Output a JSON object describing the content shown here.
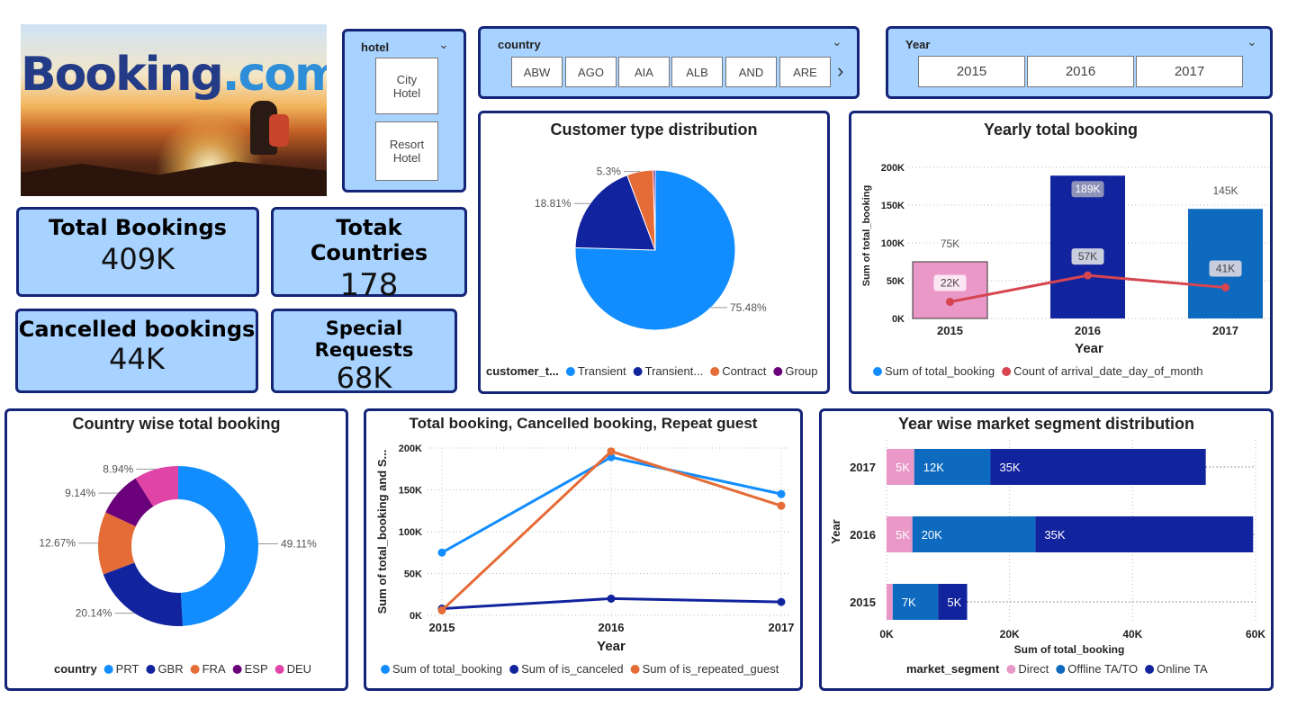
{
  "logo": {
    "text_main": "Booking",
    "text_dot": ".com"
  },
  "hotel_slicer": {
    "title": "hotel",
    "items": [
      "City Hotel",
      "Resort Hotel"
    ]
  },
  "country_slicer": {
    "title": "country",
    "items": [
      "ABW",
      "AGO",
      "AIA",
      "ALB",
      "AND",
      "ARE"
    ]
  },
  "year_slicer": {
    "title": "Year",
    "items": [
      "2015",
      "2016",
      "2017"
    ]
  },
  "kpis": {
    "total_bookings": {
      "label": "Total Bookings",
      "value": "409K"
    },
    "total_countries": {
      "label": "Totak Countries",
      "value": "178"
    },
    "cancelled": {
      "label": "Cancelled bookings",
      "value": "44K"
    },
    "special": {
      "label": "Special Requests",
      "value": "68K"
    }
  },
  "colors": {
    "light_blue": "#118dff",
    "navy": "#12239e",
    "orange": "#e66c37",
    "purple": "#6b007b",
    "pink": "#e044a7",
    "mid_blue": "#0d6abf",
    "red": "#d64550",
    "light_pink": "#e998c8"
  },
  "chart_data": [
    {
      "type": "pie",
      "title": "Customer type distribution",
      "legend_title": "customer_t...",
      "categories": [
        "Transient",
        "Transient...",
        "Contract",
        "Group"
      ],
      "values": [
        75.48,
        18.81,
        5.3,
        0.41
      ],
      "labels": [
        "75.48%",
        "18.81%",
        "5.3%",
        ""
      ]
    },
    {
      "type": "bar",
      "title": "Yearly total booking",
      "categories": [
        "2015",
        "2016",
        "2017"
      ],
      "xlabel": "Year",
      "ylabel": "Sum of total_booking",
      "ylim": [
        0,
        200000
      ],
      "yticks": [
        "0K",
        "50K",
        "100K",
        "150K",
        "200K"
      ],
      "series": [
        {
          "name": "Sum of total_booking",
          "values": [
            75000,
            189000,
            145000
          ],
          "labels": [
            "75K",
            "189K",
            "145K"
          ]
        },
        {
          "name": "Count of arrival_date_day_of_month",
          "values": [
            22000,
            57000,
            41000
          ],
          "labels": [
            "22K",
            "57K",
            "41K"
          ]
        }
      ]
    },
    {
      "type": "pie",
      "title": "Country wise total booking",
      "legend_title": "country",
      "categories": [
        "PRT",
        "GBR",
        "FRA",
        "ESP",
        "DEU"
      ],
      "values": [
        49.11,
        20.14,
        12.67,
        9.14,
        8.94
      ],
      "labels": [
        "49.11%",
        "20.14%",
        "12.67%",
        "9.14%",
        "8.94%"
      ]
    },
    {
      "type": "line",
      "title": "Total booking, Cancelled booking, Repeat guest",
      "x": [
        "2015",
        "2016",
        "2017"
      ],
      "xlabel": "Year",
      "ylabel": "Sum of total_booking and S...",
      "ylim": [
        0,
        200000
      ],
      "yticks": [
        "0K",
        "50K",
        "100K",
        "150K",
        "200K"
      ],
      "series": [
        {
          "name": "Sum of total_booking",
          "values": [
            75000,
            189000,
            145000
          ]
        },
        {
          "name": "Sum of is_canceled",
          "values": [
            8000,
            20000,
            16000
          ]
        },
        {
          "name": "Sum of is_repeated_guest",
          "values": [
            6000,
            196000,
            131000
          ]
        }
      ]
    },
    {
      "type": "bar",
      "orientation": "horizontal",
      "stacked": true,
      "title": "Year wise market segment distribution",
      "categories": [
        "2017",
        "2016",
        "2015"
      ],
      "xlabel": "Sum of total_booking",
      "ylabel": "Year",
      "legend_title": "market_segment",
      "xlim": [
        0,
        60000
      ],
      "xticks": [
        "0K",
        "20K",
        "40K",
        "60K"
      ],
      "series": [
        {
          "name": "Direct",
          "values": [
            4500,
            4200,
            1000
          ],
          "labels": [
            "5K",
            "5K",
            ""
          ]
        },
        {
          "name": "Offline TA/TO",
          "values": [
            12400,
            20000,
            7400
          ],
          "labels": [
            "12K",
            "20K",
            "7K"
          ]
        },
        {
          "name": "Online TA",
          "values": [
            35000,
            35400,
            4700
          ],
          "labels": [
            "35K",
            "35K",
            "5K"
          ]
        }
      ]
    }
  ]
}
